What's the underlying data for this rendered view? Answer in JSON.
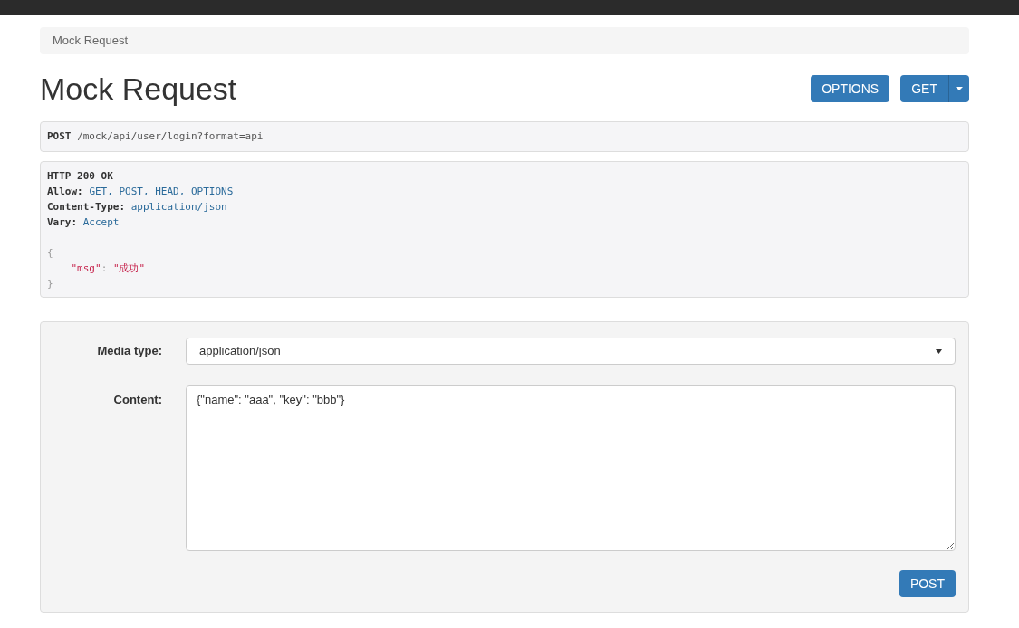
{
  "breadcrumb": "Mock Request",
  "title": "Mock Request",
  "buttons": [
    {
      "label": "OPTIONS",
      "kind": "plain"
    },
    {
      "label": "GET",
      "kind": "split"
    }
  ],
  "request": {
    "method": "POST",
    "url": "/mock/api/user/login?format=api"
  },
  "response": {
    "status": "HTTP 200 OK",
    "headers": [
      {
        "name": "Allow:",
        "value": "GET, POST, HEAD, OPTIONS"
      },
      {
        "name": "Content-Type:",
        "value": "application/json"
      },
      {
        "name": "Vary:",
        "value": "Accept"
      }
    ],
    "body": [
      [
        {
          "kind": "punct",
          "text": "{"
        }
      ],
      [
        {
          "kind": "key",
          "text": "\"msg\""
        },
        {
          "kind": "punct",
          "text": ":"
        },
        {
          "kind": "string",
          "text": "\"成功\""
        }
      ],
      [
        {
          "kind": "punct",
          "text": "}"
        }
      ]
    ]
  },
  "form": {
    "media_type": {
      "label": "Media type:",
      "value": "application/json"
    },
    "content": {
      "label": "Content:",
      "value": "{\"name\": \"aaa\", \"key\": \"bbb\"}"
    },
    "submit": "POST"
  }
}
